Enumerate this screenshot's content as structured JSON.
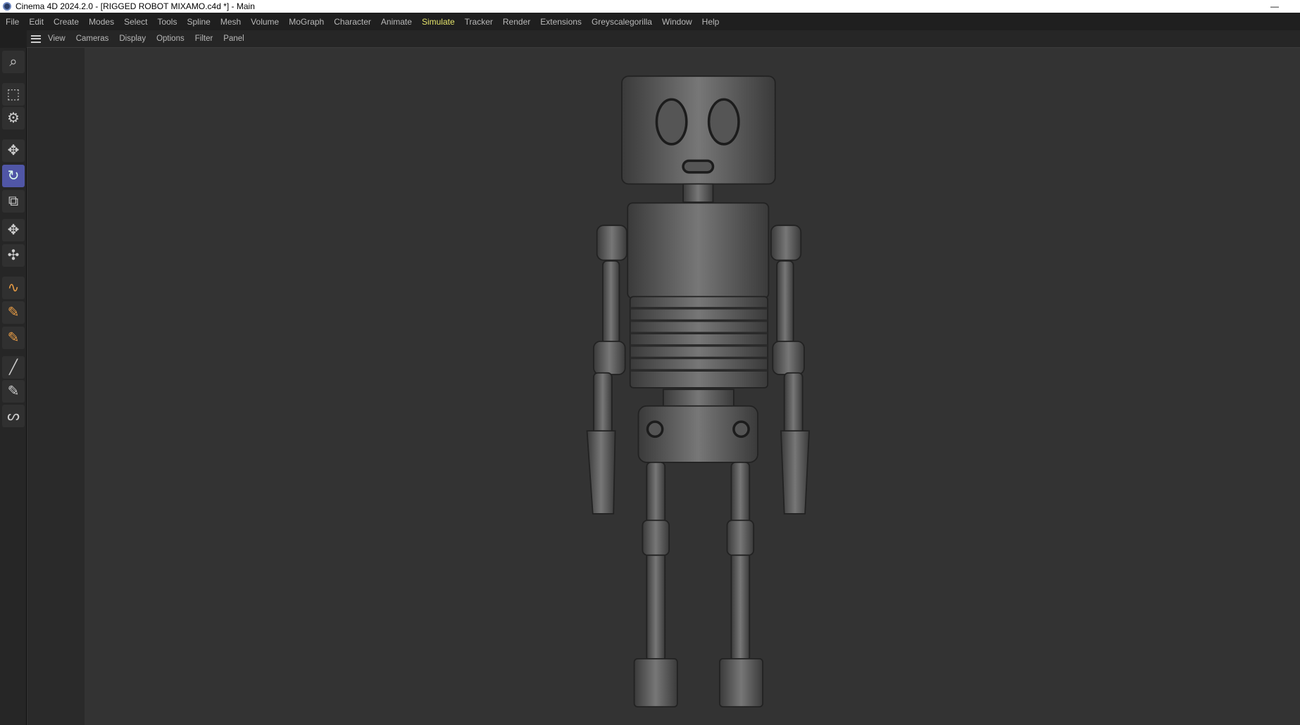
{
  "window": {
    "title": "Cinema 4D 2024.2.0 - [RIGGED ROBOT MIXAMO.c4d *] - Main",
    "minimize": "—"
  },
  "menu": [
    "File",
    "Edit",
    "Create",
    "Modes",
    "Select",
    "Tools",
    "Spline",
    "Mesh",
    "Volume",
    "MoGraph",
    "Character",
    "Animate",
    "Simulate",
    "Tracker",
    "Render",
    "Extensions",
    "Greyscalegorilla",
    "Window",
    "Help"
  ],
  "menu_active": "Simulate",
  "viewport_menu": [
    "View",
    "Cameras",
    "Display",
    "Options",
    "Filter",
    "Panel"
  ],
  "tools": [
    {
      "icon": "search-icon",
      "glyph": "⌕"
    },
    {
      "icon": "selection-icon",
      "glyph": "⬚"
    },
    {
      "icon": "gear-pointer-icon",
      "glyph": "⚙"
    },
    {
      "icon": "move-icon",
      "glyph": "✥"
    },
    {
      "icon": "rotate-icon",
      "glyph": "↻",
      "selected": true
    },
    {
      "icon": "scale-icon",
      "glyph": "⧉"
    },
    {
      "icon": "transform-icon",
      "glyph": "✥"
    },
    {
      "icon": "point-transform-icon",
      "glyph": "✣"
    },
    {
      "icon": "spline-pen-icon",
      "glyph": "∿"
    },
    {
      "icon": "pen-box-icon",
      "glyph": "✎"
    },
    {
      "icon": "pen-cubes-icon",
      "glyph": "✎"
    },
    {
      "icon": "brush-icon",
      "glyph": "╱"
    },
    {
      "icon": "pen-line-icon",
      "glyph": "✎"
    },
    {
      "icon": "sketch-icon",
      "glyph": "ᔕ"
    }
  ],
  "colors": {
    "accent": "#5056a6",
    "active_menu": "#e4e36a",
    "viewport": "#333333"
  }
}
